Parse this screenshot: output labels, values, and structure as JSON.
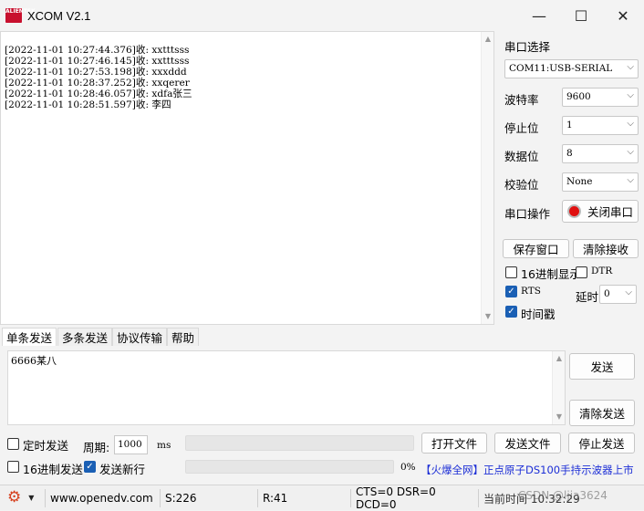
{
  "window": {
    "logo_text": "ALIENTEK",
    "title": "XCOM V2.1",
    "minimize": "—",
    "maximize": "☐",
    "close": "✕"
  },
  "receive": {
    "lines": [
      "[2022-11-01 10:27:44.376]收: xxtttsss",
      "[2022-11-01 10:27:46.145]收: xxtttsss",
      "[2022-11-01 10:27:53.198]收: xxxddd",
      "[2022-11-01 10:28:37.252]收: xxqerer",
      "[2022-11-01 10:28:46.057]收: xdfa张三",
      "[2022-11-01 10:28:51.597]收: 李四"
    ]
  },
  "port": {
    "select_label": "串口选择",
    "port_value": "COM11:USB-SERIAL",
    "baud_label": "波特率",
    "baud_value": "9600",
    "stop_label": "停止位",
    "stop_value": "1",
    "data_label": "数据位",
    "data_value": "8",
    "parity_label": "校验位",
    "parity_value": "None",
    "op_label": "串口操作",
    "close_port": "关闭串口"
  },
  "receive_controls": {
    "save_window": "保存窗口",
    "clear_receive": "清除接收",
    "hex_display": "16进制显示",
    "hex_display_checked": false,
    "dtr": "DTR",
    "dtr_checked": false,
    "rts": "RTS",
    "rts_checked": true,
    "delay_label": "延时",
    "delay_value": "0",
    "timestamp": "时间戳",
    "timestamp_checked": true
  },
  "tabs": [
    "单条发送",
    "多条发送",
    "协议传输",
    "帮助"
  ],
  "send": {
    "text": "6666某八",
    "send_button": "发送",
    "clear_send": "清除发送",
    "timed_send": "定时发送",
    "timed_checked": false,
    "period_label": "周期:",
    "period_value": "1000",
    "period_unit": "ms",
    "open_file": "打开文件",
    "send_file": "发送文件",
    "stop_send": "停止发送",
    "hex_send": "16进制发送",
    "hex_send_checked": false,
    "send_newline": "发送新行",
    "newline_checked": true,
    "progress_value": "0%",
    "progress_fraction": 0
  },
  "ad": {
    "text": "【火爆全网】正点原子DS100手持示波器上市"
  },
  "status": {
    "url": "www.openedv.com",
    "sent": "S:226",
    "received": "R:41",
    "lines": "CTS=0 DSR=0 DCD=0",
    "time": "当前时间 10:32:29",
    "watermark": "CSDN @ljia3624"
  },
  "colors": {
    "accent": "#1a5fb4",
    "ad_text": "#1d2fd6",
    "record_red": "#e01010"
  }
}
